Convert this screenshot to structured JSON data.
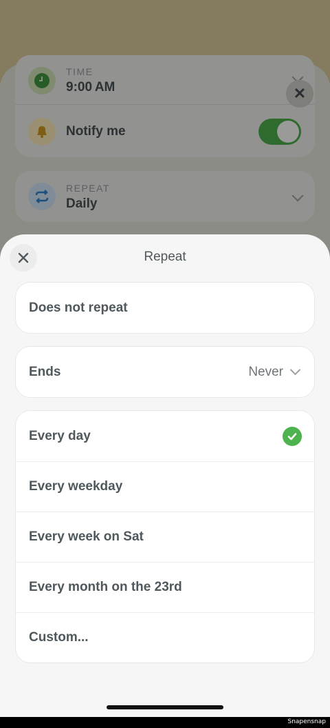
{
  "background": {
    "time": {
      "label": "TIME",
      "value": "9:00 AM",
      "icon": "clock-icon"
    },
    "notify": {
      "label": "Notify me",
      "icon": "bell-icon",
      "toggle_on": true
    },
    "repeat": {
      "label": "REPEAT",
      "value": "Daily",
      "icon": "repeat-icon"
    },
    "close_glyph": "✕"
  },
  "sheet": {
    "title": "Repeat",
    "does_not_repeat": "Does not repeat",
    "ends": {
      "label": "Ends",
      "value": "Never"
    },
    "options": [
      {
        "label": "Every day",
        "selected": true
      },
      {
        "label": "Every weekday",
        "selected": false
      },
      {
        "label": "Every week on Sat",
        "selected": false
      },
      {
        "label": "Every month on the 23rd",
        "selected": false
      },
      {
        "label": "Custom...",
        "selected": false
      }
    ]
  },
  "footer": {
    "watermark": "Snapensnap"
  },
  "colors": {
    "accent_green": "#4cb34f",
    "text": "#4f585d",
    "sheet_bg": "#f6f6f6"
  }
}
